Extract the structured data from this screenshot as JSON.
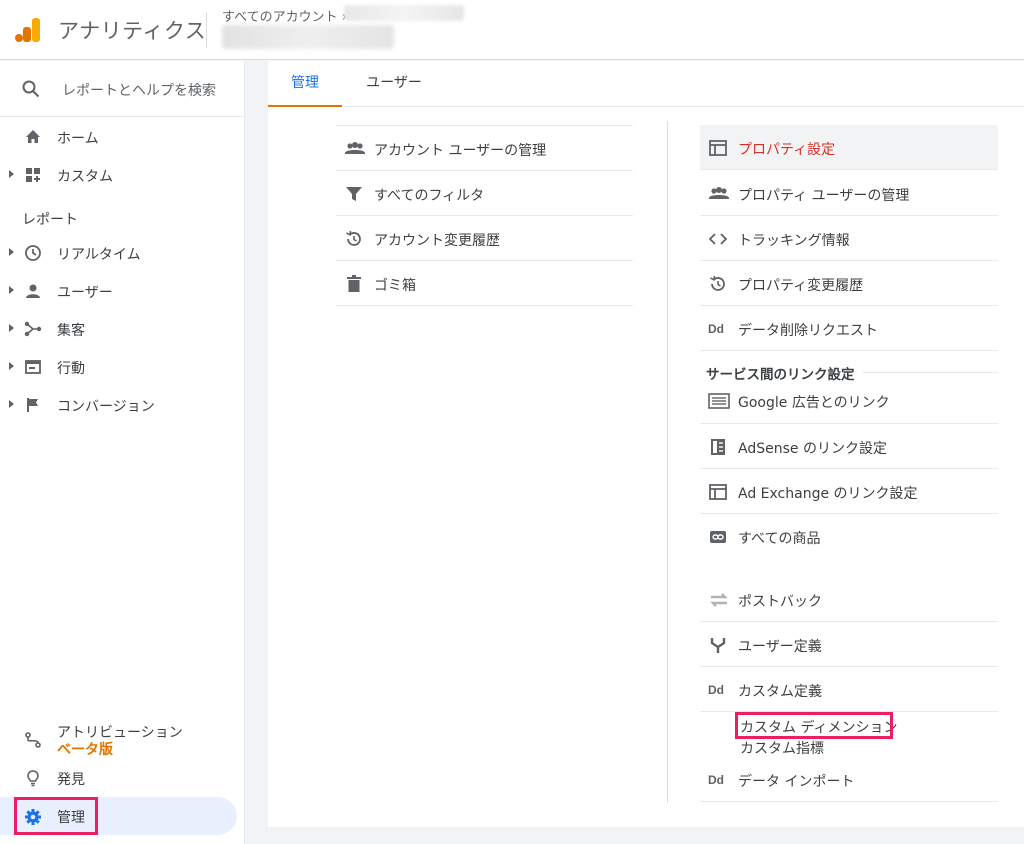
{
  "header": {
    "app_title": "アナリティクス",
    "breadcrumb": "すべてのアカウント ›"
  },
  "sidebar": {
    "search_placeholder": "レポートとヘルプを検索",
    "items_top": [
      {
        "label": "ホーム",
        "icon": "home-icon"
      },
      {
        "label": "カスタム",
        "icon": "dashboard-icon"
      }
    ],
    "section_title": "レポート",
    "report_items": [
      {
        "label": "リアルタイム",
        "icon": "clock-icon"
      },
      {
        "label": "ユーザー",
        "icon": "person-icon"
      },
      {
        "label": "集客",
        "icon": "acquisition-icon"
      },
      {
        "label": "行動",
        "icon": "behavior-icon"
      },
      {
        "label": "コンバージョン",
        "icon": "flag-icon"
      }
    ],
    "attribution": {
      "label": "アトリビューション",
      "badge": "ベータ版",
      "icon": "attribution-icon"
    },
    "discover": {
      "label": "発見",
      "icon": "lightbulb-icon"
    },
    "admin": {
      "label": "管理",
      "icon": "gear-icon"
    }
  },
  "tabs": [
    {
      "label": "管理",
      "active": true
    },
    {
      "label": "ユーザー",
      "active": false
    }
  ],
  "account_column": {
    "items": [
      {
        "label": "アカウント ユーザーの管理",
        "icon": "people-icon"
      },
      {
        "label": "すべてのフィルタ",
        "icon": "filter-icon"
      },
      {
        "label": "アカウント変更履歴",
        "icon": "history-icon"
      },
      {
        "label": "ゴミ箱",
        "icon": "trash-icon"
      }
    ]
  },
  "property_column": {
    "items": [
      {
        "label": "プロパティ設定",
        "icon": "property-icon",
        "selected": true
      },
      {
        "label": "プロパティ ユーザーの管理",
        "icon": "people-icon"
      },
      {
        "label": "トラッキング情報",
        "icon": "code-icon"
      },
      {
        "label": "プロパティ変更履歴",
        "icon": "history-icon"
      },
      {
        "label": "データ削除リクエスト",
        "icon": "dd-icon"
      }
    ],
    "link_section_title": "サービス間のリンク設定",
    "link_items": [
      {
        "label": "Google 広告とのリンク",
        "icon": "google-ads-icon"
      },
      {
        "label": "AdSense のリンク設定",
        "icon": "adsense-icon"
      },
      {
        "label": "Ad Exchange のリンク設定",
        "icon": "adexchange-icon"
      },
      {
        "label": "すべての商品",
        "icon": "link-icon"
      }
    ],
    "lower_items": [
      {
        "label": "ポストバック",
        "icon": "postback-icon"
      },
      {
        "label": "ユーザー定義",
        "icon": "fork-icon"
      },
      {
        "label": "カスタム定義",
        "icon": "dd-icon"
      }
    ],
    "custom_sub": [
      "カスタム ディメンション",
      "カスタム指標"
    ],
    "data_import": {
      "label": "データ インポート",
      "icon": "dd-icon"
    }
  },
  "colors": {
    "accent": "#1a73e8",
    "orange": "#e37400",
    "highlight": "#e91e63",
    "selected_text": "#d93025"
  }
}
